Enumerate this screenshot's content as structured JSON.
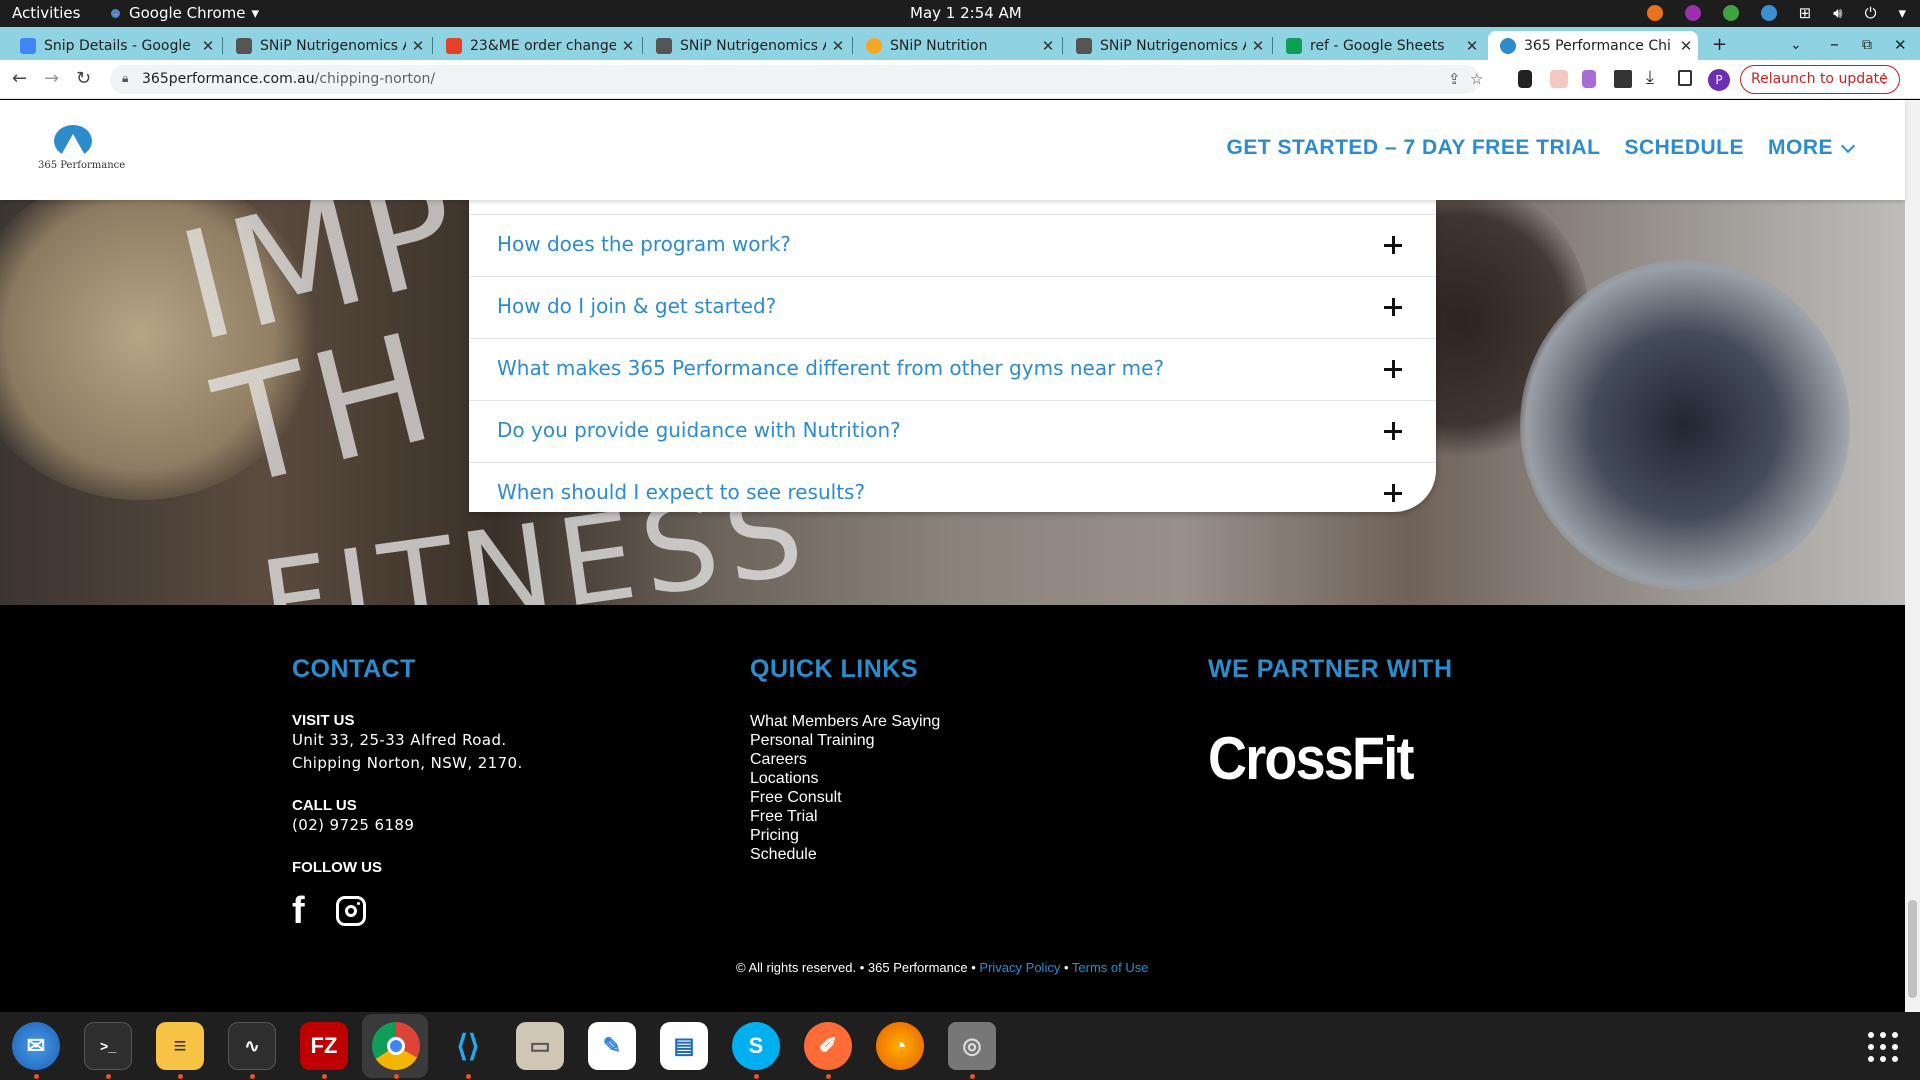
{
  "topbar": {
    "activities": "Activities",
    "app_name": "Google Chrome",
    "clock": "May 1  2:54 AM"
  },
  "tabs": [
    {
      "title": "Snip Details - Google",
      "favicon_color": "#4285f4"
    },
    {
      "title": "SNiP Nutrigenomics A",
      "favicon_color": "#555555"
    },
    {
      "title": "23&ME order change",
      "favicon_color": "#e2432a"
    },
    {
      "title": "SNiP Nutrigenomics A",
      "favicon_color": "#555555"
    },
    {
      "title": "SNiP Nutrition",
      "favicon_color": "#f5a623"
    },
    {
      "title": "SNiP Nutrigenomics A",
      "favicon_color": "#555555"
    },
    {
      "title": "ref - Google Sheets",
      "favicon_color": "#0f9d58"
    },
    {
      "title": "365 Performance Chi",
      "favicon_color": "#2d8ccb",
      "active": true
    }
  ],
  "toolbar": {
    "url_domain": "365performance.com.au",
    "url_path": "/chipping-norton/",
    "profile_initial": "P",
    "relaunch_label": "Relaunch to update"
  },
  "site": {
    "logo_text": "365 Performance",
    "nav": {
      "trial": "GET STARTED – 7 DAY FREE TRIAL",
      "schedule": "SCHEDULE",
      "more": "MORE"
    },
    "hero_shirt_text": [
      "IMP",
      "TH"
    ],
    "hero_bottom_text": "FITNESS",
    "faq": [
      "How does the program work?",
      "How do I join & get started?",
      "What makes 365 Performance different from other gyms near me?",
      "Do you provide guidance with Nutrition?",
      "When should I expect to see results?"
    ],
    "footer": {
      "contact_heading": "CONTACT",
      "visit_label": "VISIT US",
      "address_line1": "Unit 33, 25-33 Alfred Road.",
      "address_line2": "Chipping Norton, NSW, 2170.",
      "call_label": "CALL US",
      "phone": "(02) 9725 6189",
      "follow_label": "FOLLOW US",
      "quicklinks_heading": "QUICK LINKS",
      "quicklinks": [
        "What Members Are Saying",
        "Personal Training",
        "Careers",
        "Locations",
        "Free Consult",
        "Free Trial",
        "Pricing",
        "Schedule"
      ],
      "partner_heading": "WE PARTNER WITH",
      "partner_logo": "CrossFit",
      "copyright_text": "© All rights reserved. • 365 Performance •",
      "privacy_label": "Privacy Policy",
      "terms_label": "Terms of Use"
    }
  },
  "dock": [
    "thunderbird",
    "terminal",
    "notes",
    "system-monitor",
    "filezilla",
    "chrome",
    "vscode",
    "files",
    "text-editor",
    "libreoffice-writer",
    "skype",
    "postman",
    "app-orange",
    "disks"
  ]
}
